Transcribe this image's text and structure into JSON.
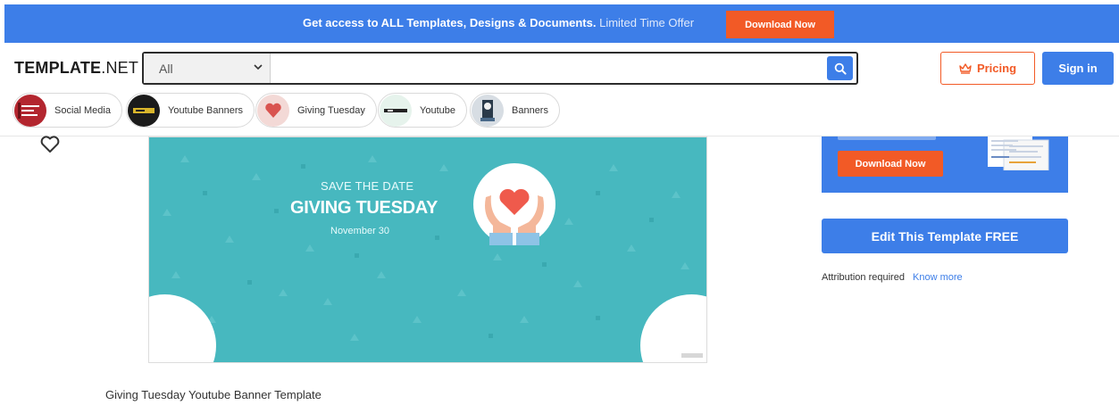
{
  "promo": {
    "text_bold": "Get access to ALL Templates, Designs & Documents.",
    "text_light": "Limited Time Offer",
    "button_label": "Download Now"
  },
  "header": {
    "logo_bold": "TEMPLATE",
    "logo_light": ".NET",
    "search": {
      "category_value": "All",
      "placeholder": "",
      "value": ""
    },
    "pricing_label": "Pricing",
    "signin_label": "Sign in"
  },
  "chips": [
    {
      "label": "Social Media"
    },
    {
      "label": "Youtube Banners"
    },
    {
      "label": "Giving Tuesday"
    },
    {
      "label": "Youtube"
    },
    {
      "label": "Banners"
    }
  ],
  "banner": {
    "save_text": "SAVE THE DATE",
    "title": "GIVING TUESDAY",
    "date": "November 30"
  },
  "sidebar": {
    "ad_button_label": "Download Now",
    "edit_button_label": "Edit This Template FREE",
    "attribution_text": "Attribution required",
    "attribution_link": "Know more"
  },
  "template_title": "Giving Tuesday Youtube Banner Template",
  "colors": {
    "accent_blue": "#3d7ee8",
    "accent_orange": "#f25a26",
    "banner_teal": "#47b8bf"
  },
  "icons": [
    "chevron-down-icon",
    "search-icon",
    "crown-icon",
    "heart-icon",
    "hands-heart-icon"
  ]
}
